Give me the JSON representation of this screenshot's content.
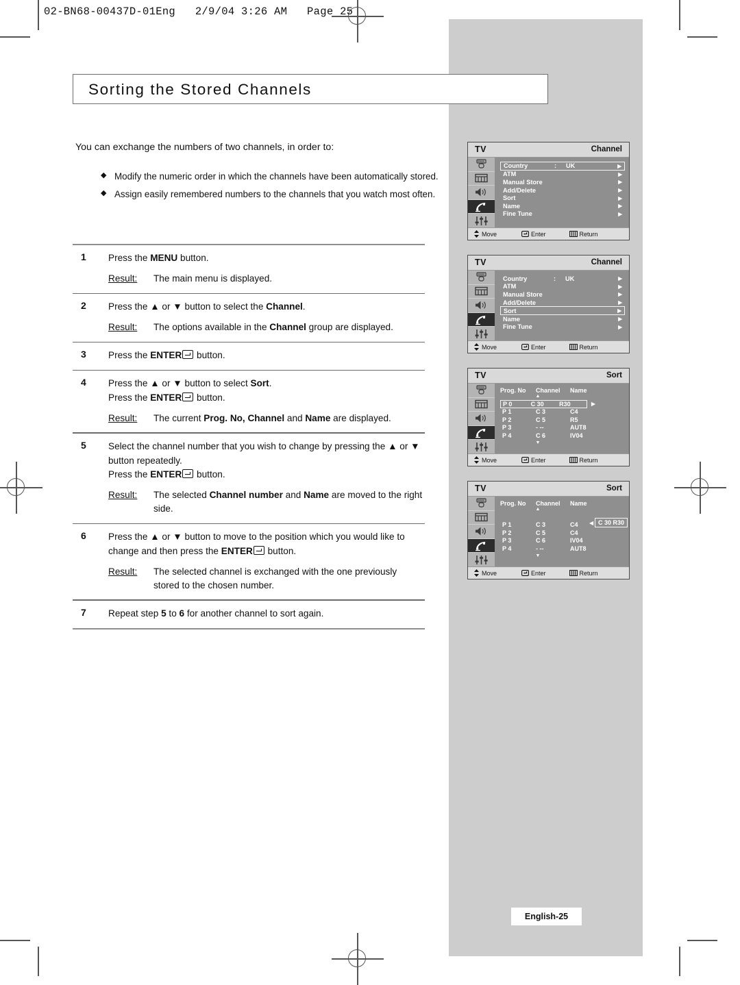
{
  "running_head": "02-BN68-00437D-01Eng   2/9/04 3:26 AM   Page 25",
  "page_title": "Sorting the Stored Channels",
  "intro": "You can exchange the numbers of two channels, in order to:",
  "bullets": [
    "Modify the numeric order in which the channels have been automatically stored.",
    "Assign easily remembered numbers to the channels that you watch most often."
  ],
  "bullet_glyph": "◆",
  "result_label": "Result:",
  "steps": [
    {
      "num": "1",
      "instruction_html": "Press the <b>MENU</b> button.",
      "result": "The main menu is displayed."
    },
    {
      "num": "2",
      "instruction_html": "Press the ▲ or ▼ button to select the <b>Channel</b>.",
      "result_html": "The options available in the <b>Channel</b> group are displayed."
    },
    {
      "num": "3",
      "instruction_html": "Press the <b>ENTER</b><span class=\"ent\"></span> button.",
      "result": ""
    },
    {
      "num": "4",
      "instruction_html": "Press the ▲ or ▼ button to select <b>Sort</b>.<br>Press the <b>ENTER</b><span class=\"ent\"></span> button.",
      "result_html": "The current <b>Prog. No, Channel</b> and <b>Name</b> are displayed."
    },
    {
      "num": "5",
      "instruction_html": "Select the channel number that you wish to change by pressing the ▲ or ▼ button repeatedly.<br>Press the <b>ENTER</b><span class=\"ent\"></span> button.",
      "result_html": "The selected <b>Channel number</b> and <b>Name</b> are moved to the right side."
    },
    {
      "num": "6",
      "instruction_html": "Press the ▲ or ▼ button to move to the position which you would like to change and then press the <b>ENTER</b><span class=\"ent\"></span> button.",
      "result_html": "The selected channel is exchanged with the one previously stored to the chosen number."
    },
    {
      "num": "7",
      "instruction_html": "Repeat step <b>5</b> to <b>6</b> for another channel to sort again.",
      "result": ""
    }
  ],
  "osd_common": {
    "tv_label": "TV",
    "bottom_bar": {
      "move": "Move",
      "enter": "Enter",
      "return": "Return"
    },
    "sidebar_icons": [
      "input-source-icon",
      "picture-icon",
      "sound-icon",
      "channel-dish-icon",
      "setup-sliders-icon"
    ],
    "active_icon_index": 3,
    "arrow_right": "▶",
    "arrow_left": "◀",
    "arrow_up": "▲",
    "arrow_down": "▼"
  },
  "osd_screens": [
    {
      "id": "channel-menu-country-selected",
      "title": "Channel",
      "type": "menu",
      "rows": [
        {
          "label": "Country",
          "colon": ":",
          "value": "UK",
          "selected": true
        },
        {
          "label": "ATM",
          "colon": "",
          "value": "",
          "selected": false
        },
        {
          "label": "Manual Store",
          "colon": "",
          "value": "",
          "selected": false
        },
        {
          "label": "Add/Delete",
          "colon": "",
          "value": "",
          "selected": false
        },
        {
          "label": "Sort",
          "colon": "",
          "value": "",
          "selected": false
        },
        {
          "label": "Name",
          "colon": "",
          "value": "",
          "selected": false
        },
        {
          "label": "Fine Tune",
          "colon": "",
          "value": "",
          "selected": false
        }
      ]
    },
    {
      "id": "channel-menu-sort-selected",
      "title": "Channel",
      "type": "menu",
      "rows": [
        {
          "label": "Country",
          "colon": ":",
          "value": "UK",
          "selected": false
        },
        {
          "label": "ATM",
          "colon": "",
          "value": "",
          "selected": false
        },
        {
          "label": "Manual Store",
          "colon": "",
          "value": "",
          "selected": false
        },
        {
          "label": "Add/Delete",
          "colon": "",
          "value": "",
          "selected": false
        },
        {
          "label": "Sort",
          "colon": "",
          "value": "",
          "selected": true
        },
        {
          "label": "Name",
          "colon": "",
          "value": "",
          "selected": false
        },
        {
          "label": "Fine Tune",
          "colon": "",
          "value": "",
          "selected": false
        }
      ]
    },
    {
      "id": "sort-screen-row-selected",
      "title": "Sort",
      "type": "table",
      "headers": [
        "Prog. No",
        "Channel",
        "Name"
      ],
      "rows": [
        {
          "prog": "P 0",
          "channel": "C 30",
          "name": "R30",
          "selected": true
        },
        {
          "prog": "P 1",
          "channel": "C  3",
          "name": "C4",
          "selected": false
        },
        {
          "prog": "P 2",
          "channel": "C  5",
          "name": "R5",
          "selected": false
        },
        {
          "prog": "P 3",
          "channel": "-  --",
          "name": "AUT8",
          "selected": false
        },
        {
          "prog": "P 4",
          "channel": "C  6",
          "name": "IV04",
          "selected": false
        }
      ],
      "float_box": null
    },
    {
      "id": "sort-screen-channel-moved",
      "title": "Sort",
      "type": "table",
      "headers": [
        "Prog. No",
        "Channel",
        "Name"
      ],
      "rows": [
        {
          "prog": "",
          "channel": "",
          "name": "",
          "selected": false,
          "blank": true
        },
        {
          "prog": "P 1",
          "channel": "C  3",
          "name": "C4",
          "selected": false
        },
        {
          "prog": "P 2",
          "channel": "C  5",
          "name": "C4",
          "selected": false
        },
        {
          "prog": "P 3",
          "channel": "C  6",
          "name": "IV04",
          "selected": false
        },
        {
          "prog": "P 4",
          "channel": "-  --",
          "name": "AUT8",
          "selected": false
        }
      ],
      "float_box": "C 30  R30"
    }
  ],
  "footer": "English-25"
}
